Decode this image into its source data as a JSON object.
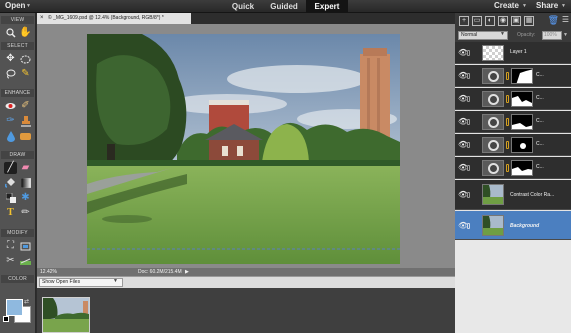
{
  "menu": {
    "open": "Open",
    "create": "Create",
    "share": "Share",
    "modes": [
      "Quick",
      "Guided",
      "Expert"
    ],
    "active_mode": "Expert"
  },
  "tools_panel": {
    "sections": [
      "VIEW",
      "SELECT",
      "ENHANCE",
      "DRAW",
      "MODIFY",
      "COLOR"
    ]
  },
  "document": {
    "tab_title": "© _MG_1609.psd @ 12.4% (Background, RGB/8*) *",
    "zoom": "12.42%",
    "doc_size": "Doc: 60.2M/215.4M"
  },
  "photo_bin": {
    "selector": "Show Open Files"
  },
  "layers": {
    "blend_mode": "Normal",
    "opacity_label": "Opacity:",
    "opacity_value": "100%",
    "items": [
      {
        "name": "Layer 1",
        "kind": "pixel"
      },
      {
        "name": "C...",
        "kind": "adjustment"
      },
      {
        "name": "C...",
        "kind": "adjustment"
      },
      {
        "name": "C...",
        "kind": "adjustment"
      },
      {
        "name": "C...",
        "kind": "adjustment"
      },
      {
        "name": "C...",
        "kind": "adjustment"
      },
      {
        "name": "Contrast Color Ra...",
        "kind": "image"
      },
      {
        "name": "Background",
        "kind": "image",
        "active": true
      }
    ]
  },
  "colors": {
    "foreground": "#8fb9df",
    "background": "#ffffff",
    "active_layer": "#4b7fc0",
    "active_mode_tab": "#141414"
  }
}
